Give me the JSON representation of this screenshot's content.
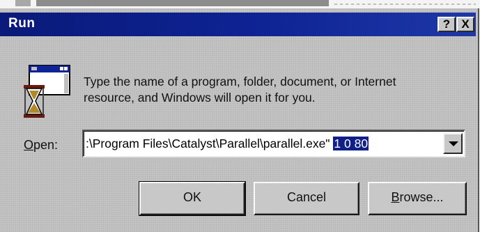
{
  "window": {
    "title": "Run"
  },
  "titlebar_buttons": {
    "help": "?",
    "close": "X"
  },
  "description": {
    "line1": "Type the name of a program, folder, document, or Internet",
    "line2": "resource, and Windows will open it for you."
  },
  "open_field": {
    "label_accel": "O",
    "label_rest": "pen:",
    "value_plain": ":\\Program Files\\Catalyst\\Parallel\\parallel.exe\"",
    "value_selected": "1 0 80"
  },
  "buttons": {
    "ok": "OK",
    "cancel": "Cancel",
    "browse_accel": "B",
    "browse_rest": "rowse..."
  },
  "icons": {
    "run": "run-program-icon",
    "dropdown": "chevron-down-icon"
  }
}
